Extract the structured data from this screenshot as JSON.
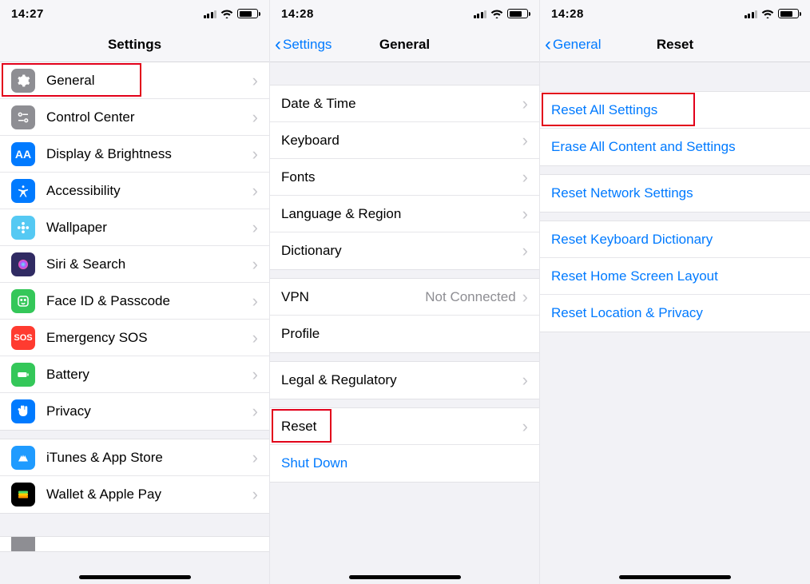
{
  "screen1": {
    "time": "14:27",
    "title": "Settings",
    "groups": [
      [
        {
          "label": "General",
          "icon": "gear-icon",
          "bg": "#8e8e93"
        },
        {
          "label": "Control Center",
          "icon": "sliders-icon",
          "bg": "#8e8e93"
        },
        {
          "label": "Display & Brightness",
          "icon": "aa-icon",
          "bg": "#007aff"
        },
        {
          "label": "Accessibility",
          "icon": "accessibility-icon",
          "bg": "#007aff"
        },
        {
          "label": "Wallpaper",
          "icon": "flower-icon",
          "bg": "#55c9f3"
        },
        {
          "label": "Siri & Search",
          "icon": "siri-icon",
          "bg": "#302b63"
        },
        {
          "label": "Face ID & Passcode",
          "icon": "face-icon",
          "bg": "#34c759"
        },
        {
          "label": "Emergency SOS",
          "icon": "sos-icon",
          "bg": "#ff3b30"
        },
        {
          "label": "Battery",
          "icon": "battery-icon",
          "bg": "#34c759"
        },
        {
          "label": "Privacy",
          "icon": "hand-icon",
          "bg": "#007aff"
        }
      ],
      [
        {
          "label": "iTunes & App Store",
          "icon": "appstore-icon",
          "bg": "#1f9bff"
        },
        {
          "label": "Wallet & Apple Pay",
          "icon": "wallet-icon",
          "bg": "#000000"
        }
      ]
    ],
    "highlight_key": "General"
  },
  "screen2": {
    "time": "14:28",
    "back": "Settings",
    "title": "General",
    "groups": [
      [
        {
          "label": "Date & Time"
        },
        {
          "label": "Keyboard"
        },
        {
          "label": "Fonts"
        },
        {
          "label": "Language & Region"
        },
        {
          "label": "Dictionary"
        }
      ],
      [
        {
          "label": "VPN",
          "detail": "Not Connected"
        },
        {
          "label": "Profile",
          "no_chevron": true
        }
      ],
      [
        {
          "label": "Legal & Regulatory"
        }
      ],
      [
        {
          "label": "Reset"
        },
        {
          "label": "Shut Down",
          "blue": true,
          "no_chevron": true
        }
      ]
    ],
    "highlight_key": "Reset"
  },
  "screen3": {
    "time": "14:28",
    "back": "General",
    "title": "Reset",
    "groups": [
      [
        {
          "label": "Reset All Settings",
          "blue": true,
          "no_chevron": true
        },
        {
          "label": "Erase All Content and Settings",
          "blue": true,
          "no_chevron": true
        }
      ],
      [
        {
          "label": "Reset Network Settings",
          "blue": true,
          "no_chevron": true
        }
      ],
      [
        {
          "label": "Reset Keyboard Dictionary",
          "blue": true,
          "no_chevron": true
        },
        {
          "label": "Reset Home Screen Layout",
          "blue": true,
          "no_chevron": true
        },
        {
          "label": "Reset Location & Privacy",
          "blue": true,
          "no_chevron": true
        }
      ]
    ],
    "highlight_key": "Reset All Settings"
  }
}
